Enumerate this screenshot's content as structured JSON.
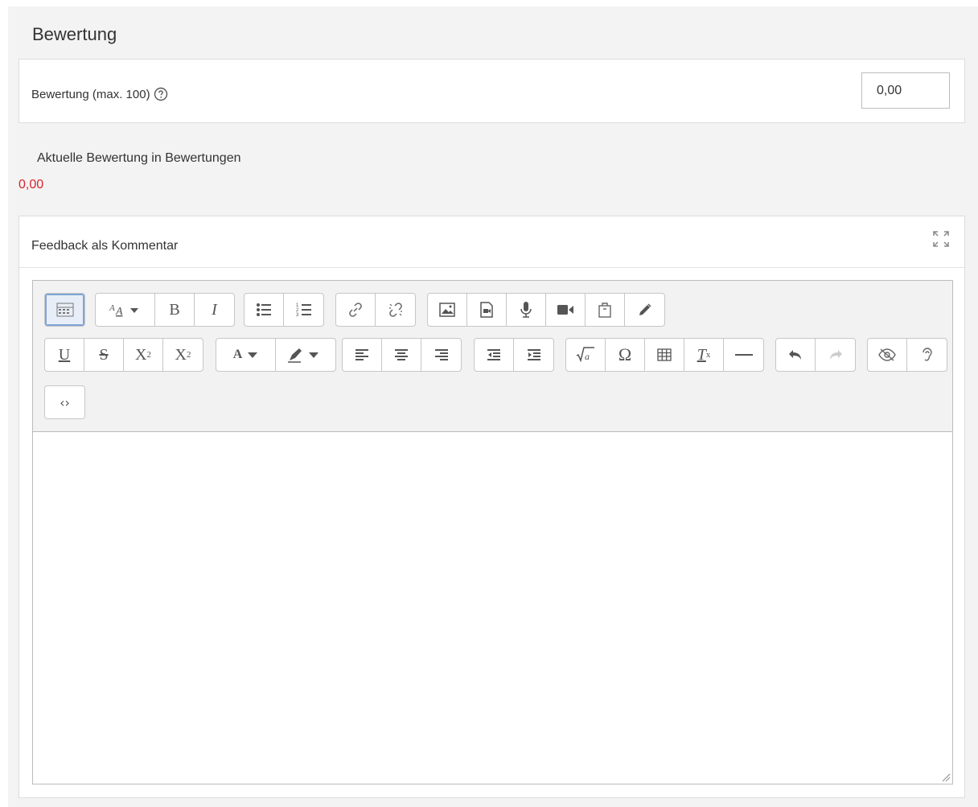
{
  "section": {
    "title": "Bewertung"
  },
  "grade": {
    "label": "Bewertung (max. 100)",
    "value": "0,00",
    "help_icon": "question-circle-icon"
  },
  "current": {
    "label": "Aktuelle Bewertung in Bewertungen",
    "value": "0,00",
    "value_color": "#d9242a"
  },
  "feedback": {
    "label": "Feedback als Kommentar",
    "expand_icon": "fullscreen-expand-icon",
    "content": ""
  },
  "toolbar": {
    "row1": [
      [
        "toolbar-toggle-icon"
      ],
      [
        "paragraph-style-icon",
        "bold-icon",
        "italic-icon"
      ],
      [
        "unordered-list-icon",
        "ordered-list-icon"
      ],
      [
        "link-icon",
        "unlink-icon"
      ],
      [
        "image-icon",
        "media-icon",
        "record-audio-icon",
        "record-video-icon",
        "manage-files-icon",
        "pencil-icon"
      ]
    ],
    "row2": [
      [
        "underline-icon",
        "strikethrough-icon",
        "subscript-icon",
        "superscript-icon"
      ],
      [
        "font-color-icon",
        "background-color-icon"
      ],
      [
        "align-left-icon",
        "align-center-icon",
        "align-right-icon"
      ],
      [
        "outdent-icon",
        "indent-icon"
      ],
      [
        "equation-icon",
        "special-character-icon",
        "table-icon",
        "clear-formatting-icon",
        "horizontal-rule-icon"
      ],
      [
        "undo-icon",
        "redo-icon"
      ],
      [
        "accessibility-checker-icon",
        "screenreader-helper-icon"
      ]
    ],
    "row3": [
      [
        "html-source-icon"
      ]
    ],
    "text": {
      "bold": "B",
      "italic": "I",
      "underline": "U",
      "strike": "S",
      "sub": "X",
      "sub_index": "2",
      "sup": "X",
      "sup_index": "2",
      "omega": "Ω",
      "font_color": "A",
      "clear_format": "T",
      "clear_format_index": "x",
      "source": "‹›"
    }
  }
}
